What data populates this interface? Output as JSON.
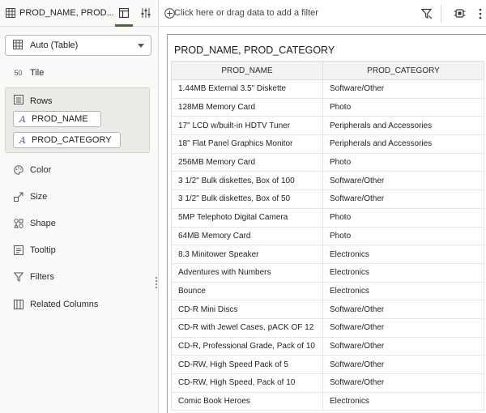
{
  "header": {
    "tab_title": "PROD_NAME, PROD...",
    "filter_placeholder": "Click here or drag data to add a filter"
  },
  "viz_type": {
    "label": "Auto (Table)"
  },
  "grammar": {
    "tile": "Tile",
    "rows": "Rows",
    "row_pills": [
      "PROD_NAME",
      "PROD_CATEGORY"
    ],
    "color": "Color",
    "size": "Size",
    "shape": "Shape",
    "tooltip": "Tooltip",
    "filters": "Filters",
    "related_columns": "Related Columns"
  },
  "canvas": {
    "title": "PROD_NAME, PROD_CATEGORY",
    "columns": [
      "PROD_NAME",
      "PROD_CATEGORY"
    ],
    "rows": [
      [
        "1.44MB External 3.5\" Diskette",
        "Software/Other"
      ],
      [
        "128MB Memory Card",
        "Photo"
      ],
      [
        "17\" LCD w/built-in HDTV Tuner",
        "Peripherals and Accessories"
      ],
      [
        "18\" Flat Panel Graphics Monitor",
        "Peripherals and Accessories"
      ],
      [
        "256MB Memory Card",
        "Photo"
      ],
      [
        "3 1/2\" Bulk diskettes, Box of 100",
        "Software/Other"
      ],
      [
        "3 1/2\" Bulk diskettes, Box of 50",
        "Software/Other"
      ],
      [
        "5MP Telephoto Digital Camera",
        "Photo"
      ],
      [
        "64MB Memory Card",
        "Photo"
      ],
      [
        "8.3 Minitower Speaker",
        "Electronics"
      ],
      [
        "Adventures with Numbers",
        "Electronics"
      ],
      [
        "Bounce",
        "Electronics"
      ],
      [
        "CD-R Mini Discs",
        "Software/Other"
      ],
      [
        "CD-R with Jewel Cases, pACK OF 12",
        "Software/Other"
      ],
      [
        "CD-R, Professional Grade, Pack of 10",
        "Software/Other"
      ],
      [
        "CD-RW, High Speed Pack of 5",
        "Software/Other"
      ],
      [
        "CD-RW, High Speed, Pack of 10",
        "Software/Other"
      ],
      [
        "Comic Book Heroes",
        "Electronics"
      ]
    ]
  },
  "icons": {
    "table": "table-icon",
    "grammar_panel": "grammar-panel-icon",
    "properties": "properties-icon",
    "add_filter": "add-filter-icon",
    "filter_funnel": "funnel-icon",
    "canvas_menu": "canvas-menu-icon",
    "more": "more-vertical-icon",
    "dropdown": "chevron-down-icon"
  },
  "colors": {
    "accent": "#4a6a3e",
    "attribute_icon": "#6b4aa6",
    "canvas_border": "#8fa785"
  }
}
